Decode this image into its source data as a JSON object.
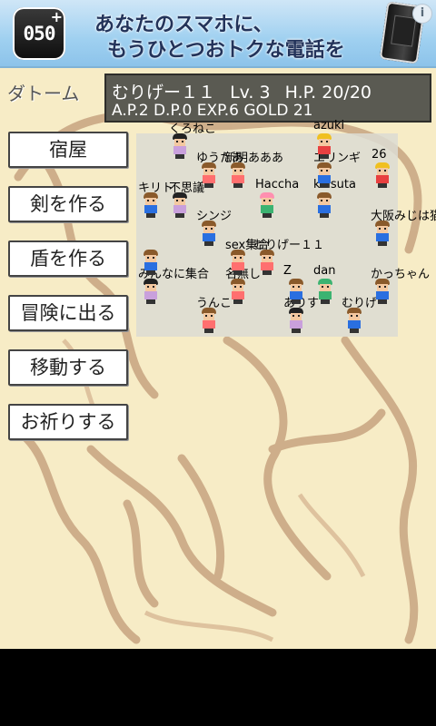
{
  "ad": {
    "logo_text": "050",
    "logo_plus": "+",
    "line1": "あなたのスマホに、",
    "line2": "もうひとつおトクな電話を",
    "info": "i"
  },
  "game": {
    "town_name": "ダトーム",
    "status": {
      "name": "むりげー１１",
      "lv_label": "Lv.",
      "lv": "3",
      "hp_label": "H.P.",
      "hp": "20/20",
      "ap": "A.P.2",
      "dp": "D.P.0",
      "exp": "EXP.6",
      "gold": "GOLD 21"
    },
    "menu": [
      "宿屋",
      "剣を作る",
      "盾を作る",
      "冒険に出る",
      "移動する",
      "お祈りする"
    ],
    "labels": [
      "くろねこ",
      "azuki",
      "ゆうたあ",
      "新明あああ",
      "エリンギ",
      "26",
      "キリト",
      "不思議",
      "Haccha",
      "kaisuta",
      "シンジ",
      "大阪みじは猫",
      "むりげー１１",
      "sex集合",
      "みんなに集合",
      "名無し",
      "Z",
      "dan",
      "かっちゃん",
      "うんこ",
      "ありす",
      "むりげ"
    ]
  },
  "colors": {
    "ground": "#f7ecc6",
    "path": "#c7a480",
    "status_bg": "#5a5a52",
    "ad_bg": "#9fd0f0"
  }
}
